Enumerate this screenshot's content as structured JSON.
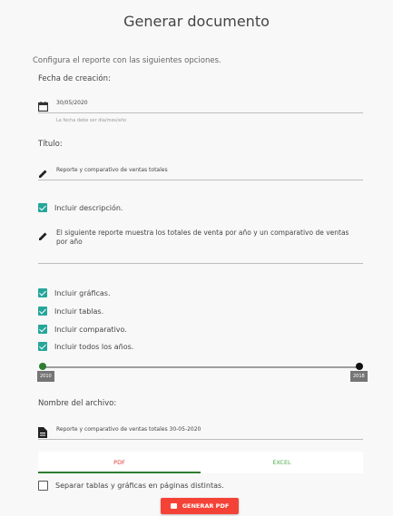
{
  "dialog": {
    "title": "Generar documento",
    "subtitle": "Configura el reporte con las siguientes opciones."
  },
  "fecha": {
    "label": "Fecha de creación:",
    "value": "30/05/2020",
    "hint": "La fecha debe ser día/mes/año",
    "icon": "calendar-icon"
  },
  "titulo": {
    "label": "Título:",
    "value": "Reporte y comparativo de ventas totales",
    "icon": "pencil-icon"
  },
  "descripcion": {
    "checkbox_label": "Incluir descripción.",
    "checked": true,
    "value": "El siguiente reporte muestra los totales de venta por año y un comparativo de ventas por año",
    "icon": "pencil-icon"
  },
  "opciones": [
    {
      "label": "Incluir gráficas.",
      "checked": true
    },
    {
      "label": "Incluir tablas.",
      "checked": true
    },
    {
      "label": "Incluir comparativo.",
      "checked": true
    },
    {
      "label": "Incluir todos los años.",
      "checked": true
    }
  ],
  "slider": {
    "min_label": "2010",
    "max_label": "2018",
    "min_value": 2010,
    "max_value": 2018,
    "colors": {
      "start_thumb": "#2e7d32",
      "end_thumb": "#111111"
    }
  },
  "archivo": {
    "label": "Nombre del archivo:",
    "value": "Reporte y comparativo de ventas totales 30-05-2020",
    "icon": "file-icon"
  },
  "tabs": {
    "pdf": "PDF",
    "excel": "EXCEL",
    "active": "PDF"
  },
  "separar": {
    "label": "Separar tablas y gráficas en páginas distintas.",
    "checked": false
  },
  "button": {
    "label": "GENERAR PDF",
    "icon": "pdf-icon",
    "color": "#f44336"
  }
}
